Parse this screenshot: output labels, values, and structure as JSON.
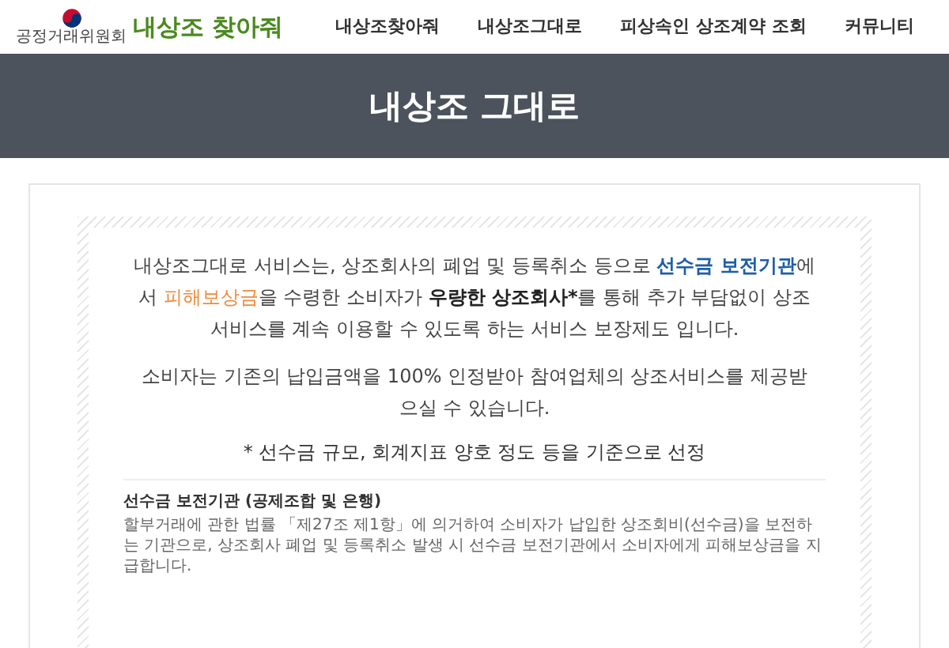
{
  "header": {
    "logo_caption": "공정거래위원회",
    "site_name": "내상조 찾아줘",
    "nav": [
      {
        "label": "내상조찾아줘"
      },
      {
        "label": "내상조그대로"
      },
      {
        "label": "피상속인 상조계약 조회"
      },
      {
        "label": "커뮤니티"
      }
    ]
  },
  "banner": {
    "title": "내상조 그대로"
  },
  "intro": [
    [
      {
        "kind": "plain",
        "text": "내상조그대로 서비스는, 상조회사의 폐업 및 등록취소 등으로 "
      },
      {
        "kind": "blue",
        "text": "선수금 보전기관"
      },
      {
        "kind": "plain",
        "text": "에서 "
      },
      {
        "kind": "orange",
        "text": "피해보상금"
      },
      {
        "kind": "plain",
        "text": "을 수령한 소비자가 "
      },
      {
        "kind": "bold",
        "text": "우량한 상조회사*"
      },
      {
        "kind": "plain",
        "text": "를 통해 추가 부담없이 상조서비스를 계속 이용할 수 있도록 하는 서비스 보장제도 입니다."
      }
    ],
    [
      {
        "kind": "plain",
        "text": "소비자는 기존의 납입금액을 100% 인정받아 참여업체의 상조서비스를 제공받으실 수 있습니다."
      }
    ]
  ],
  "footnote": "* 선수금 규모, 회계지표 양호 정도 등을 기준으로 선정",
  "definition": {
    "title": "선수금 보전기관 (공제조합 및 은행)",
    "text": "할부거래에 관한 법률 「제27조 제1항」에 의거하여 소비자가 납입한 상조회비(선수금)을 보전하는 기관으로, 상조회사 폐업 및 등록취소 발생 시 선수금 보전기관에서 소비자에게 피해보상금을 지급합니다."
  }
}
